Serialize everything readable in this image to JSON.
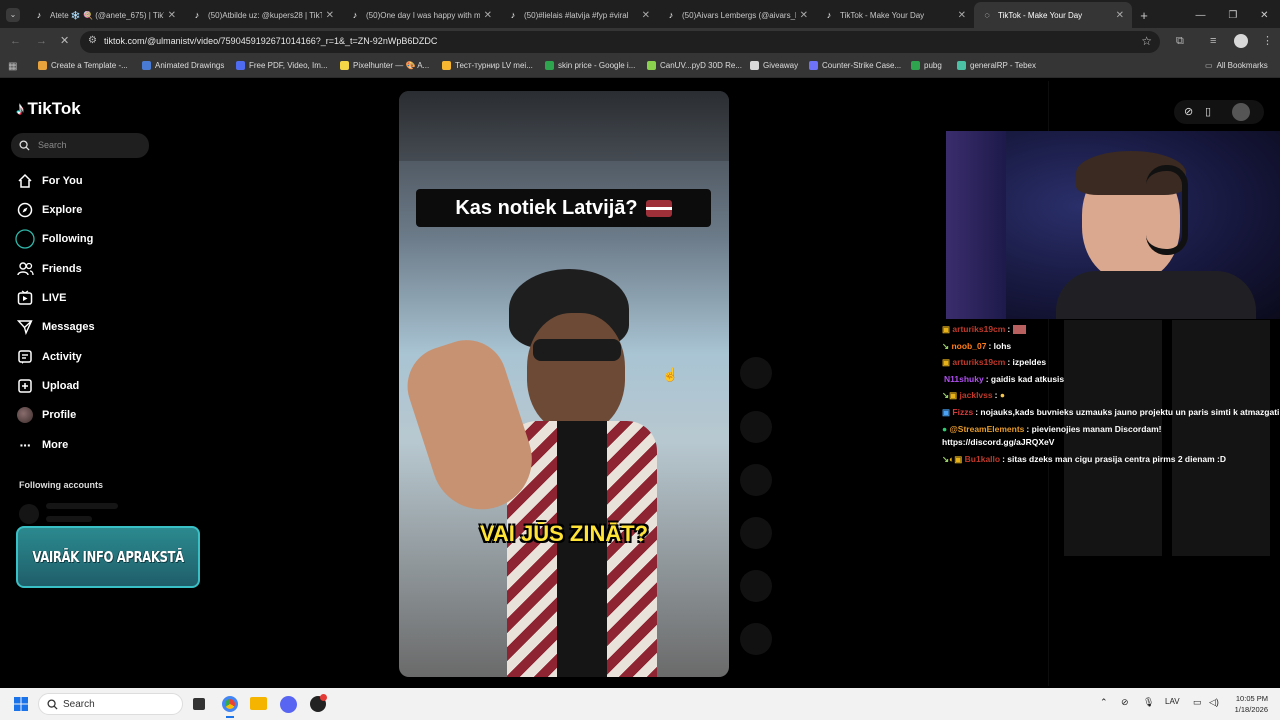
{
  "browser": {
    "tabs": [
      {
        "label": "Atete ❄️ 🍭 (@anete_675) | TikTok",
        "active": false
      },
      {
        "label": "(50)Atbilde uz: @kupers28 | TikTok",
        "active": false
      },
      {
        "label": "(50)One day I was happy with my life",
        "active": false
      },
      {
        "label": "(50)#lielais #latvija #fyp #viral",
        "active": false
      },
      {
        "label": "(50)Aivars Lembergs (@aivars_l",
        "active": false
      },
      {
        "label": "TikTok - Make Your Day",
        "active": false
      },
      {
        "label": "TikTok - Make Your Day",
        "active": true
      }
    ],
    "url": "tiktok.com/@ulmanistv/video/7590459192671014166?_r=1&_t=ZN-92nWpB6DZDC",
    "bookmarks": [
      {
        "label": "Create a Template -...",
        "color": "#e8a33d"
      },
      {
        "label": "Animated Drawings",
        "color": "#4a7bd4"
      },
      {
        "label": "Free PDF, Video, Im...",
        "color": "#4f6cf0"
      },
      {
        "label": "Pixelhunter — 🎨 A...",
        "color": "#f6d547"
      },
      {
        "label": "Тест-турнир LV mei...",
        "color": "#f7b731"
      },
      {
        "label": "skin price - Google i...",
        "color": "#2ea44f"
      },
      {
        "label": "CanUV...pyD 30D Re...",
        "color": "#8ad14e"
      },
      {
        "label": "Giveaway",
        "color": "#d9d9d9"
      },
      {
        "label": "Counter-Strike Case...",
        "color": "#6d72f6"
      },
      {
        "label": "pubg",
        "color": "#2ea44f"
      },
      {
        "label": "generalRP - Tebex",
        "color": "#4bc0a5"
      }
    ],
    "all_bookmarks": "All Bookmarks"
  },
  "sidebar": {
    "logo": "TikTok",
    "search_placeholder": "Search",
    "items": [
      {
        "label": "For You",
        "icon": "home-icon"
      },
      {
        "label": "Explore",
        "icon": "compass-icon"
      },
      {
        "label": "Following",
        "icon": "following-icon"
      },
      {
        "label": "Friends",
        "icon": "friends-icon"
      },
      {
        "label": "LIVE",
        "icon": "live-icon"
      },
      {
        "label": "Messages",
        "icon": "messages-icon"
      },
      {
        "label": "Activity",
        "icon": "activity-icon"
      },
      {
        "label": "Upload",
        "icon": "upload-icon"
      },
      {
        "label": "Profile",
        "icon": "avatar-icon"
      },
      {
        "label": "More",
        "icon": "more-icon"
      }
    ],
    "following_accounts": "Following accounts",
    "promo_banner": "VAIRĀK INFO APRAKSTĀ"
  },
  "video": {
    "title_caption": "Kas notiek Latvijā?",
    "subtitle_caption": "VAI JŪS ZINĀT?"
  },
  "stream_chat": [
    {
      "user": "arturiks19cm",
      "color": "#c0392b",
      "text": ""
    },
    {
      "user": "noob_07",
      "color": "#ff7e1a",
      "text": "lohs"
    },
    {
      "user": "arturiks19cm",
      "color": "#c0392b",
      "text": "izpeldes"
    },
    {
      "user": "N11shuky",
      "color": "#b04ff0",
      "text": "gaidis kad atkusis"
    },
    {
      "user": "jacklvss",
      "color": "#c0392b",
      "text": ""
    },
    {
      "user": "Fizzs",
      "color": "#d63a3a",
      "text": "nojauks,kads buvnieks uzmauks jauno projektu un paris simti k atmazgati"
    },
    {
      "user": "@StreamElements",
      "color": "#e59a2b",
      "text": "pievienojies manam Discordam! https://discord.gg/aJRQXeV"
    },
    {
      "user": "Bu1kallo",
      "color": "#c0392b",
      "text": "sitas dzeks man cigu prasija centra pirms 2 dienam :D"
    }
  ],
  "taskbar": {
    "search": "Search",
    "lang": "LAV",
    "time": "10:05 PM",
    "date": "1/18/2026"
  }
}
